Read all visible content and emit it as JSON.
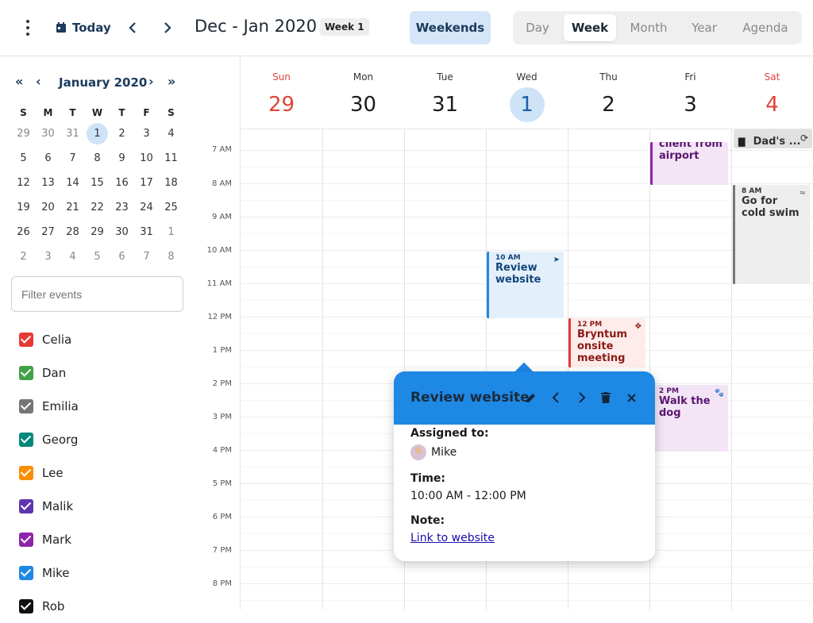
{
  "toolbar": {
    "today_label": "Today",
    "range_title": "Dec - Jan 2020",
    "week_badge": "Week 1",
    "weekends_label": "Weekends",
    "views": [
      "Day",
      "Week",
      "Month",
      "Year",
      "Agenda"
    ],
    "active_view": "Week"
  },
  "mini_calendar": {
    "title": "January 2020",
    "dow": [
      "S",
      "M",
      "T",
      "W",
      "T",
      "F",
      "S"
    ],
    "weeks": [
      [
        "29",
        "30",
        "31",
        "1",
        "2",
        "3",
        "4"
      ],
      [
        "5",
        "6",
        "7",
        "8",
        "9",
        "10",
        "11"
      ],
      [
        "12",
        "13",
        "14",
        "15",
        "16",
        "17",
        "18"
      ],
      [
        "19",
        "20",
        "21",
        "22",
        "23",
        "24",
        "25"
      ],
      [
        "26",
        "27",
        "28",
        "29",
        "30",
        "31",
        "1"
      ],
      [
        "2",
        "3",
        "4",
        "5",
        "6",
        "7",
        "8"
      ]
    ],
    "today": "1"
  },
  "filter": {
    "placeholder": "Filter events"
  },
  "resources": [
    {
      "name": "Celia",
      "color": "#e53935"
    },
    {
      "name": "Dan",
      "color": "#43a047"
    },
    {
      "name": "Emilia",
      "color": "#757575"
    },
    {
      "name": "Georg",
      "color": "#00897b"
    },
    {
      "name": "Lee",
      "color": "#fb8c00"
    },
    {
      "name": "Malik",
      "color": "#5e35b1"
    },
    {
      "name": "Mark",
      "color": "#8e24aa"
    },
    {
      "name": "Mike",
      "color": "#1e88e5"
    },
    {
      "name": "Rob",
      "color": "#111111"
    }
  ],
  "days": [
    {
      "name": "Sun",
      "date": "29"
    },
    {
      "name": "Mon",
      "date": "30"
    },
    {
      "name": "Tue",
      "date": "31"
    },
    {
      "name": "Wed",
      "date": "1"
    },
    {
      "name": "Thu",
      "date": "2"
    },
    {
      "name": "Fri",
      "date": "3"
    },
    {
      "name": "Sat",
      "date": "4"
    }
  ],
  "time_labels": [
    "7 AM",
    "8 AM",
    "9 AM",
    "10 AM",
    "11 AM",
    "12 PM",
    "1 PM",
    "2 PM",
    "3 PM",
    "4 PM",
    "5 PM",
    "6 PM",
    "7 PM",
    "8 PM"
  ],
  "allday_event": {
    "name": "Dad's ...",
    "icon": "cake-icon"
  },
  "events": [
    {
      "id": "airport",
      "time": "",
      "name": "client from airport",
      "color": "#8e24aa"
    },
    {
      "id": "swim",
      "time": "8 AM",
      "name": "Go for cold swim",
      "color": "#757575"
    },
    {
      "id": "review",
      "time": "10 AM",
      "name": "Review website",
      "color": "#1e88e5"
    },
    {
      "id": "bryntum",
      "time": "12 PM",
      "name": "Bryntum onsite meeting",
      "color": "#e53935"
    },
    {
      "id": "dog",
      "time": "2 PM",
      "name": "Walk the dog",
      "color": "#8e24aa"
    }
  ],
  "popup": {
    "title": "Review website",
    "assigned_label": "Assigned to:",
    "assigned_value": "Mike",
    "time_label": "Time:",
    "time_value": "10:00 AM - 12:00 PM",
    "note_label": "Note:",
    "note_link": "Link to website"
  }
}
